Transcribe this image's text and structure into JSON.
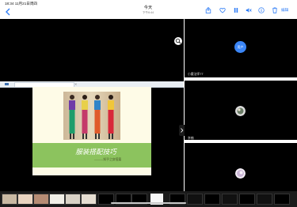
{
  "status_bar": {
    "time_date": "18:34  11月21日周四"
  },
  "header": {
    "title": "今天",
    "subtitle": "下午6:44",
    "edit_label": "编辑"
  },
  "slide": {
    "title": "服装搭配技巧",
    "byline": "———知乎之穿搭篇"
  },
  "participants": [
    {
      "label": "小魔法师TT",
      "avatar_text": "用户"
    },
    {
      "label": "李楠"
    },
    {
      "label": ""
    }
  ],
  "icons": {
    "back": "chevron-left-icon",
    "share": "share-icon",
    "favorite": "heart-icon",
    "pause": "pause-icon",
    "mute": "mute-icon",
    "info": "info-icon",
    "delete": "trash-icon",
    "zoom": "magnify-icon"
  },
  "colors": {
    "accent": "#2f7df6",
    "slide_band": "#8cc35e",
    "slide_bg": "#fefbe7"
  }
}
